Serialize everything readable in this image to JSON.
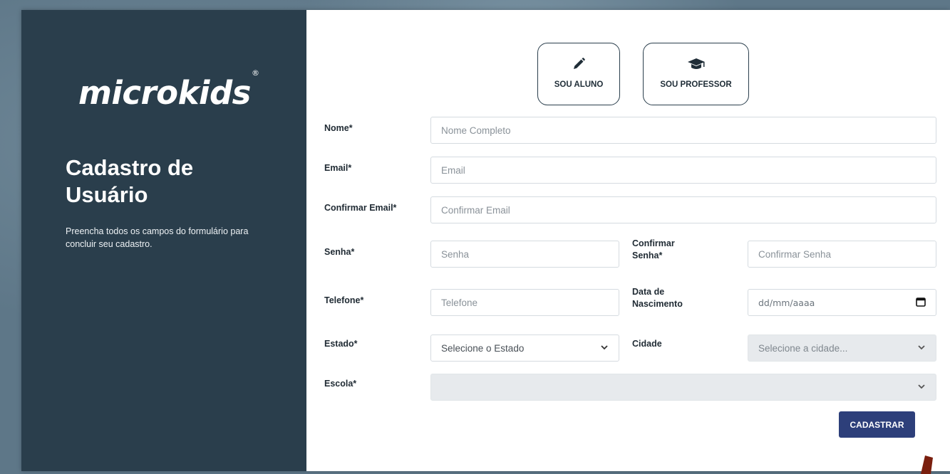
{
  "brand": {
    "logo": "microkids",
    "registered": "®"
  },
  "left_panel": {
    "title_line1": "Cadastro de",
    "title_line2": "Usuário",
    "subtitle": "Preencha todos os campos do formulário para concluir seu cadastro."
  },
  "roles": {
    "aluno_label": "SOU ALUNO",
    "aluno_icon": "pencil-icon",
    "professor_label": "SOU PROFESSOR",
    "professor_icon": "graduation-cap-icon"
  },
  "form": {
    "nome_label": "Nome*",
    "nome_placeholder": "Nome Completo",
    "email_label": "Email*",
    "email_placeholder": "Email",
    "confirm_email_label": "Confirmar Email*",
    "confirm_email_placeholder": "Confirmar Email",
    "senha_label": "Senha*",
    "senha_placeholder": "Senha",
    "confirm_senha_label_1": "Confirmar",
    "confirm_senha_label_2": "Senha*",
    "confirm_senha_placeholder": "Confirmar Senha",
    "telefone_label": "Telefone*",
    "telefone_placeholder": "Telefone",
    "nascimento_label_1": "Data de",
    "nascimento_label_2": "Nascimento",
    "nascimento_value": "dd/mm/aaaa",
    "estado_label": "Estado*",
    "estado_selected": "Selecione o Estado",
    "cidade_label": "Cidade",
    "cidade_selected": "Selecione a cidade...",
    "escola_label": "Escola*",
    "escola_selected": "",
    "submit_label": "CADASTRAR"
  },
  "colors": {
    "panel": "#2a3e4c",
    "submit": "#2d3f7a",
    "disabled_select": "#e7eaed"
  }
}
